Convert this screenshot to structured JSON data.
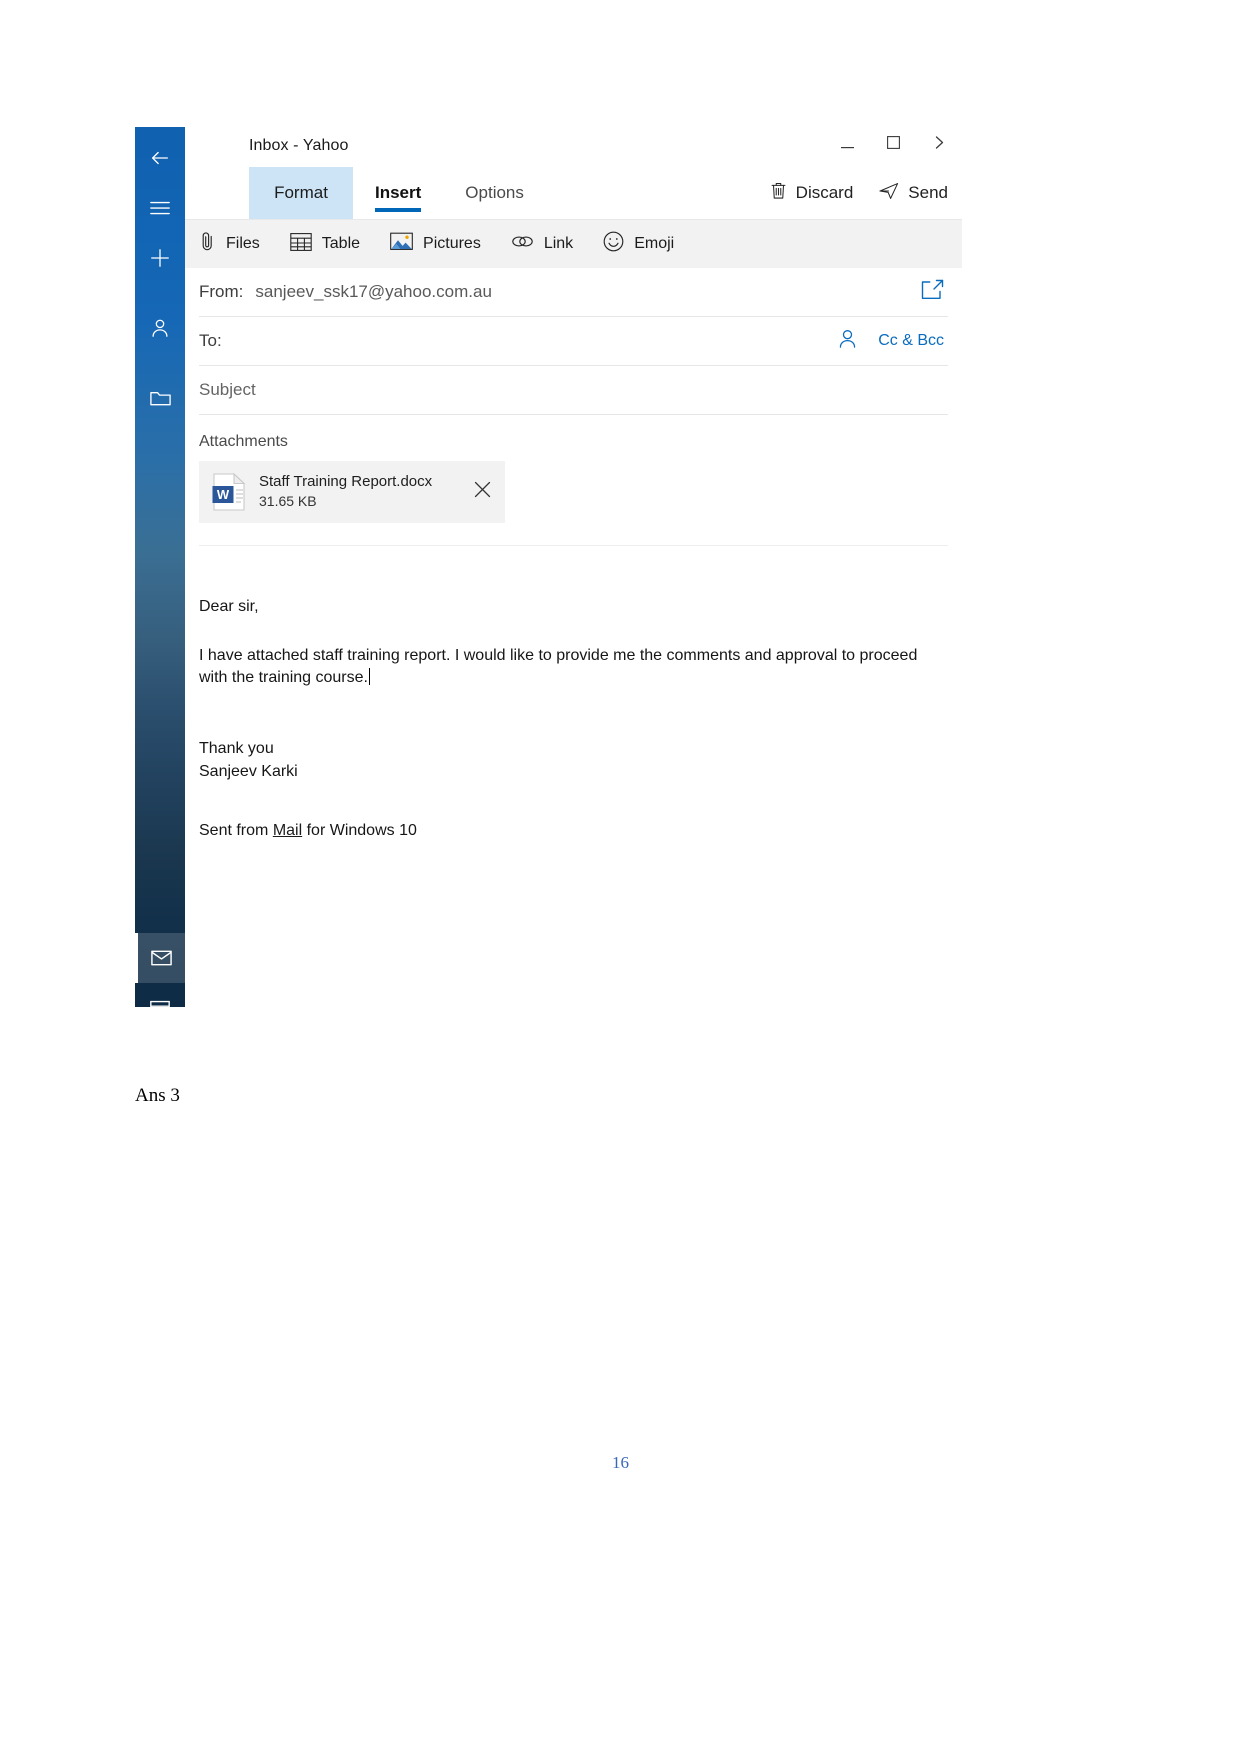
{
  "document": {
    "note": "Ans 3",
    "page_number": "16"
  },
  "window": {
    "title": "Inbox - Yahoo",
    "controls": [
      {
        "name": "minimize",
        "glyph": "minimize-icon"
      },
      {
        "name": "maximize",
        "glyph": "maximize-icon"
      },
      {
        "name": "expand",
        "glyph": "chevron-right-icon"
      }
    ]
  },
  "rail": {
    "items": [
      {
        "name": "back",
        "icon": "arrow-left-icon"
      },
      {
        "name": "menu",
        "icon": "hamburger-icon"
      },
      {
        "name": "new-mail",
        "icon": "plus-icon"
      },
      {
        "name": "accounts",
        "icon": "person-icon"
      },
      {
        "name": "folders",
        "icon": "folder-icon"
      },
      {
        "name": "mail",
        "icon": "envelope-icon"
      },
      {
        "name": "calendar",
        "icon": "calendar-icon"
      }
    ]
  },
  "tabs": [
    {
      "label": "Format",
      "state": "highlighted"
    },
    {
      "label": "Insert",
      "state": "active"
    },
    {
      "label": "Options",
      "state": "normal"
    }
  ],
  "tab_actions": [
    {
      "label": "Discard",
      "icon": "trash-icon"
    },
    {
      "label": "Send",
      "icon": "send-icon"
    }
  ],
  "ribbon": [
    {
      "label": "Files",
      "icon": "paperclip-icon"
    },
    {
      "label": "Table",
      "icon": "table-icon"
    },
    {
      "label": "Pictures",
      "icon": "image-icon"
    },
    {
      "label": "Link",
      "icon": "link-icon"
    },
    {
      "label": "Emoji",
      "icon": "smiley-icon"
    }
  ],
  "compose": {
    "from_label": "From:",
    "from_value": "sanjeev_ssk17@yahoo.com.au",
    "popout_icon": "popout-icon",
    "to_label": "To:",
    "to_value": "",
    "to_person_icon": "person-add-icon",
    "cc_bcc_label": "Cc & Bcc",
    "subject_placeholder": "Subject",
    "subject_value": "",
    "attachments_label": "Attachments",
    "attachment": {
      "name": "Staff Training Report.docx",
      "size": "31.65 KB",
      "icon": "word-doc-icon",
      "remove_icon": "close-icon"
    }
  },
  "body": {
    "greeting": "Dear sir,",
    "paragraph": "I have attached staff training report. I would like to provide me the comments and approval to proceed with the training course.",
    "closing": "Thank you",
    "signature": "Sanjeev Karki",
    "sent_from_prefix": "Sent from ",
    "sent_from_link": "Mail",
    "sent_from_suffix": " for Windows 10"
  },
  "colors": {
    "accent": "#0067b8",
    "tab_highlight": "#cce4f6",
    "link": "#0a6cbe",
    "page_number": "#3b68b5",
    "ribbon_bg": "#f2f2f2"
  }
}
